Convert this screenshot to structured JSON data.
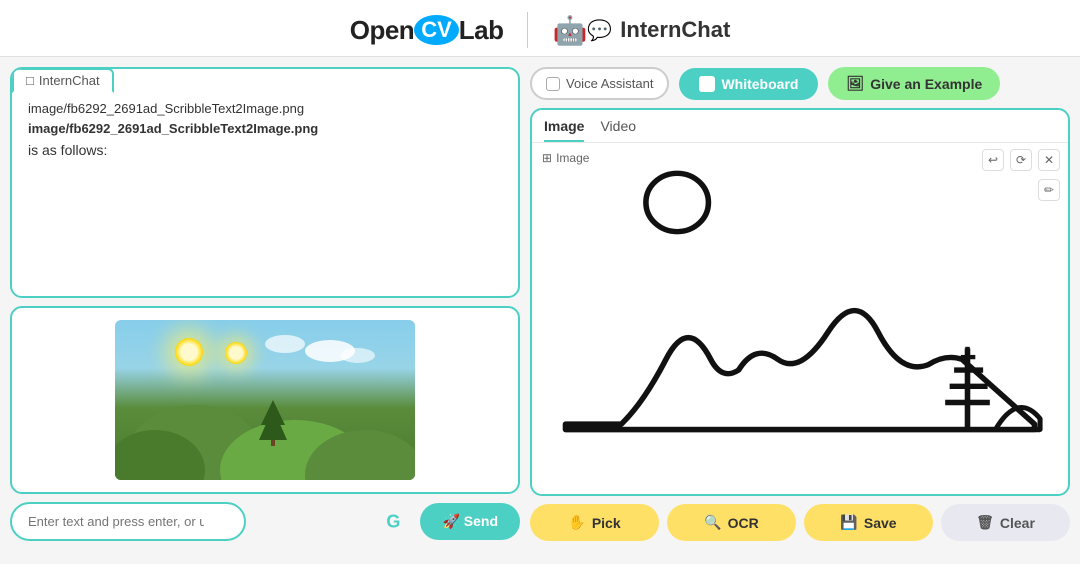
{
  "header": {
    "logo_open": "Open",
    "logo_cv": "CV",
    "logo_lab": "Lab",
    "divider": "|",
    "internchat_label": "InternChat"
  },
  "chat": {
    "tab_label": "InternChat",
    "path_line1": "image/fb6292_2691ad_ScribbleText2Image.png",
    "path_line_bold": "image/fb6292_2691ad_ScribbleText2Image.png",
    "follows_label": "is as follows:"
  },
  "input": {
    "placeholder": "Enter text and press enter, or upload an image",
    "send_label": "Send"
  },
  "toolbar": {
    "voice_assistant_label": "Voice Assistant",
    "whiteboard_label": "Whiteboard",
    "give_example_label": "Give an Example"
  },
  "canvas": {
    "image_tab": "Image",
    "video_tab": "Video",
    "label": "Image",
    "controls": {
      "undo": "↩",
      "reset": "⟳",
      "close": "✕",
      "pencil": "✏"
    }
  },
  "actions": {
    "pick_label": "Pick",
    "ocr_label": "OCR",
    "save_label": "Save",
    "clear_label": "Clear"
  },
  "icons": {
    "robot": "🤖",
    "chat_bubble": "💬",
    "send_emoji": "🚀",
    "pick_emoji": "👆",
    "ocr_emoji": "🔍",
    "save_emoji": "💾",
    "clear_emoji": "🗑",
    "example_emoji": "🖼",
    "whiteboard_square": "⬜",
    "g_icon": "G"
  }
}
